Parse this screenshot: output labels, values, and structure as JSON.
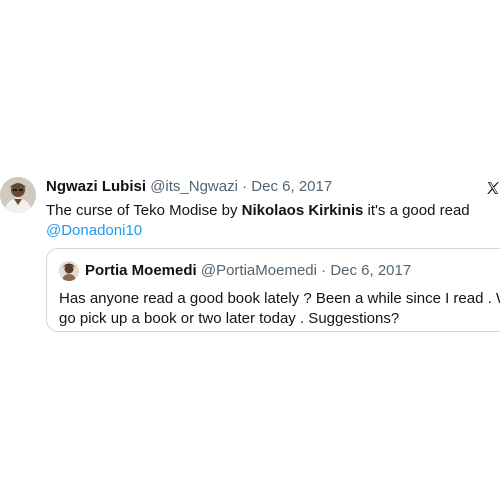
{
  "tweet": {
    "author_name": "Ngwazi Lubisi",
    "author_handle": "@its_Ngwazi",
    "separator": "·",
    "date": "Dec 6, 2017",
    "text_prefix": "The curse of Teko Modise by ",
    "text_bold": "Nikolaos Kirkinis",
    "text_suffix": " it's a good read",
    "mention": "@Donadoni10",
    "avatar_icon": "person-avatar",
    "brand_icon": "x-logo-icon"
  },
  "quoted_tweet": {
    "author_name": "Portia Moemedi",
    "author_handle": "@PortiaMoemedi",
    "separator": "·",
    "date": "Dec 6, 2017",
    "text_line1": "Has anyone read a good book lately ? Been a while since I read . Want to",
    "text_line2": "go pick up a book or two later today . Suggestions?",
    "avatar_icon": "person-avatar"
  },
  "colors": {
    "text_primary": "#0f1419",
    "text_secondary": "#536471",
    "link": "#1d9bf0",
    "border": "#cfd9de"
  }
}
